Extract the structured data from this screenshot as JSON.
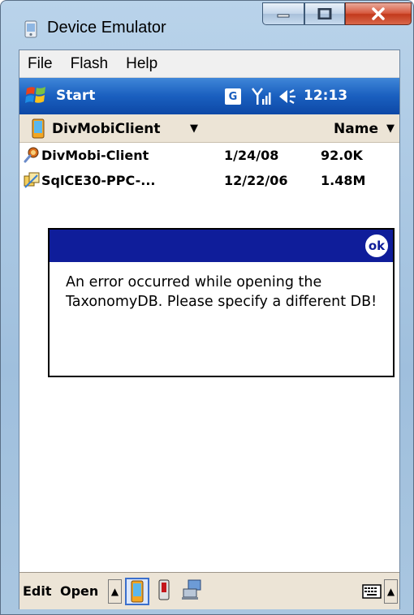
{
  "window": {
    "title": "Device Emulator"
  },
  "menubar": {
    "items": [
      "File",
      "Flash",
      "Help"
    ]
  },
  "taskbar": {
    "start_label": "Start",
    "network_badge": "G",
    "clock": "12:13"
  },
  "folderbar": {
    "folder": "DivMobiClient",
    "sort": "Name"
  },
  "files": [
    {
      "name": "DivMobi-Client",
      "date": "1/24/08",
      "size": "92.0K",
      "icon": "app-icon"
    },
    {
      "name": "SqlCE30-PPC-...",
      "date": "12/22/06",
      "size": "1.48M",
      "icon": "installer-icon"
    }
  ],
  "dialog": {
    "ok_label": "ok",
    "message": "An error occurred while opening the TaxonomyDB. Please specify a different DB!"
  },
  "bottombar": {
    "edit_label": "Edit",
    "open_label": "Open"
  },
  "colors": {
    "taskbar_blue": "#1a5fbf",
    "dialog_header": "#0f1d9a",
    "chrome_beige": "#ece4d6"
  }
}
